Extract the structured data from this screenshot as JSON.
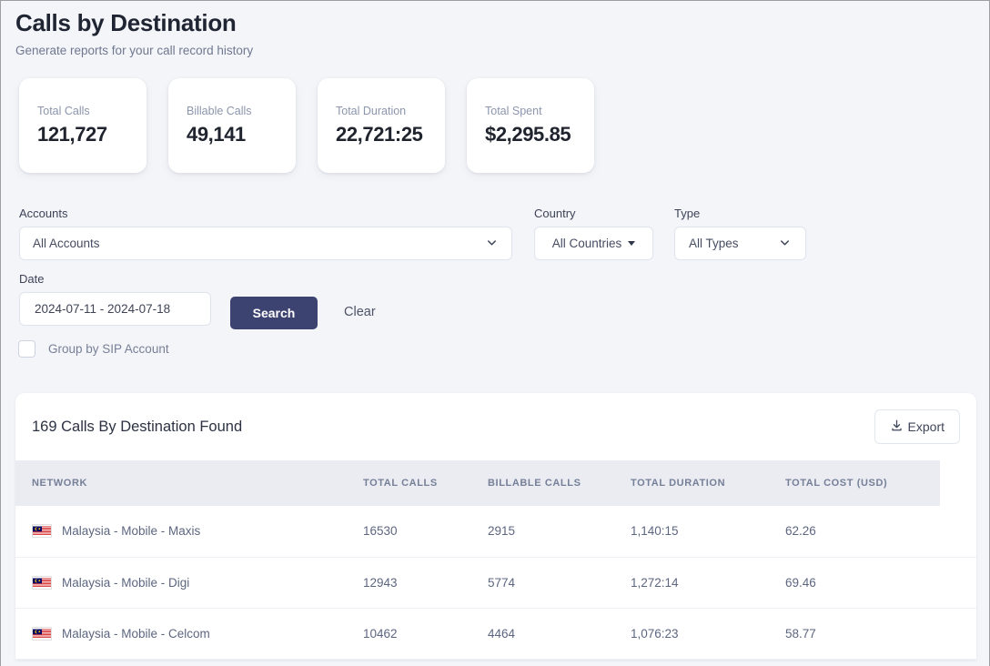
{
  "header": {
    "title": "Calls by Destination",
    "subtitle": "Generate reports for your call record history"
  },
  "stats": [
    {
      "label": "Total Calls",
      "value": "121,727"
    },
    {
      "label": "Billable Calls",
      "value": "49,141"
    },
    {
      "label": "Total Duration",
      "value": "22,721:25"
    },
    {
      "label": "Total Spent",
      "value": "$2,295.85"
    }
  ],
  "filters": {
    "accounts_label": "Accounts",
    "accounts_value": "All Accounts",
    "country_label": "Country",
    "country_value": "All Countries",
    "type_label": "Type",
    "type_value": "All Types",
    "date_label": "Date",
    "date_value": "2024-07-11 - 2024-07-18",
    "search_label": "Search",
    "clear_label": "Clear",
    "group_by_label": "Group by SIP Account",
    "group_by_checked": false
  },
  "results": {
    "found_text": "169 Calls By Destination Found",
    "export_label": "Export",
    "columns": [
      "NETWORK",
      "TOTAL CALLS",
      "BILLABLE CALLS",
      "TOTAL DURATION",
      "TOTAL COST (USD)"
    ],
    "rows": [
      {
        "flag": "malaysia-flag-icon",
        "network": "Malaysia - Mobile - Maxis",
        "total_calls": "16530",
        "billable_calls": "2915",
        "total_duration": "1,140:15",
        "total_cost": "62.26"
      },
      {
        "flag": "malaysia-flag-icon",
        "network": "Malaysia - Mobile - Digi",
        "total_calls": "12943",
        "billable_calls": "5774",
        "total_duration": "1,272:14",
        "total_cost": "69.46"
      },
      {
        "flag": "malaysia-flag-icon",
        "network": "Malaysia - Mobile - Celcom",
        "total_calls": "10462",
        "billable_calls": "4464",
        "total_duration": "1,076:23",
        "total_cost": "58.77"
      }
    ]
  },
  "colors": {
    "accent": "#3d4370",
    "page_background": "#f4f5f9",
    "table_header_background": "#eaecf2"
  }
}
